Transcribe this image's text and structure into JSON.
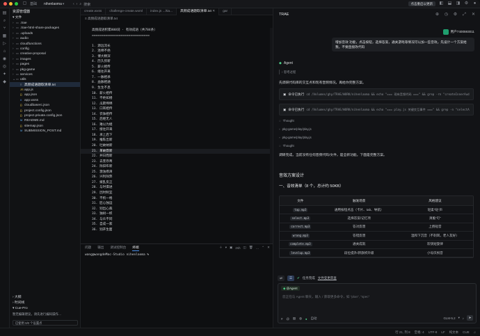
{
  "titlebar": {
    "app_label": "基础",
    "project": "nihenlaoma",
    "search_placeholder": "搜索",
    "update_badge": "点击重启以更新"
  },
  "explorer": {
    "title": "资源管理器",
    "root": "文件",
    "items": [
      {
        "name": ".trae",
        "type": "folder"
      },
      {
        "name": ".trae-html-share-packages",
        "type": "folder"
      },
      {
        "name": ".uploads",
        "type": "folder"
      },
      {
        "name": "audio",
        "type": "folder"
      },
      {
        "name": "cloudfunctions",
        "type": "folder"
      },
      {
        "name": "config",
        "type": "folder"
      },
      {
        "name": "creative-proposal",
        "type": "folder"
      },
      {
        "name": "images",
        "type": "folder"
      },
      {
        "name": "pages",
        "type": "folder"
      },
      {
        "name": "pkg-game",
        "type": "folder"
      },
      {
        "name": "services",
        "type": "folder"
      },
      {
        "name": "utils",
        "type": "folder-open"
      },
      {
        "name": "高频成语题取清单.txt",
        "type": "txt",
        "selected": true
      },
      {
        "name": "app.js",
        "type": "js"
      },
      {
        "name": "app.json",
        "type": "json"
      },
      {
        "name": "app.wxss",
        "type": "css"
      },
      {
        "name": "cloudbaserc.json",
        "type": "json"
      },
      {
        "name": "project.config.json",
        "type": "json"
      },
      {
        "name": "project.private.config.json",
        "type": "json"
      },
      {
        "name": "README.md",
        "type": "md"
      },
      {
        "name": "sitemap.json",
        "type": "json"
      },
      {
        "name": "SUBMISSION_POST.md",
        "type": "md"
      }
    ],
    "outline_label": "大纲",
    "timeline_label": "时间线",
    "cue_title": "Cue-Pro",
    "cue_text": "暂无编辑建议，请先进行编码操作…",
    "cue_status": "已使用 0/0 个设置点"
  },
  "editor": {
    "tabs": [
      "create.wxss",
      "challenge-create.wxml",
      "index.js .../tia...",
      "高频成语题取清单.txt",
      "gar"
    ],
    "active_tab": 3,
    "breadcrumb": "高频成语题取清单.txt",
    "lines": [
      "高频成语积累800词 · 有效成语（共784条）",
      "==============================",
      "",
      "1. 源远流长",
      "2. 连绵不绝",
      "3. 博大精深",
      "4. 历久弥新",
      "5. 薪火相传",
      "6. 继往开来",
      "7. 一脉相承",
      "8. 血脉相通",
      "9. 生生不息",
      "10. 薪火相传",
      "11. 不绝如缕",
      "12. 瓜瓞绵绵",
      "13. 口耳相传",
      "14. 衣钵相传",
      "15. 后继无人",
      "16. 难以为继",
      "17. 接往开来",
      "18. 承上启下",
      "19. 推陈出新",
      "20. 吐故纳新",
      "21. 革故鼎新",
      "22. 并日而新",
      "23. 去芜存菁",
      "24. 除旧布新",
      "25. 激浊扬清",
      "26. 兴利除弊",
      "27. 拨乱反正",
      "28. 与时俱进",
      "29. 因时制宜",
      "30. 不拘一格",
      "31. 匠心独运",
      "32. 别出心裁",
      "33. 独树一帜",
      "34. 与众不同",
      "35. 自成一家",
      "36. 别开生面"
    ],
    "highlight_line": 21,
    "terminal": {
      "tabs": [
        "问题",
        "输出",
        "调试控制台",
        "终端"
      ],
      "active": 3,
      "shell": "zsh",
      "prompt": "wang@wangdeMac-Studio nihenlaoma %"
    }
  },
  "panel": {
    "title": "TRAE",
    "user_name": "用户7400593011",
    "user_message": "增加音效 功能，点击按钮，选择答案，通关游戏等情况可以加一些音效。先设计一个方案给我，不要直接改代码",
    "agent_label": "Agent",
    "thinking_label": "思考过程",
    "intro": "先调研代码库的交互点和现有音频情况，再给你完整方案。",
    "cmd1_label": "命令已执行",
    "cmd1_path": "cd /Volumes/ghy/TRAE/WORK/nihenlaoma && echo \"=== 现有音频代码 ===\" && grep -rn \"createInnerAudioCo",
    "cmd2_label": "命令已执行",
    "cmd2_path": "cd /Volumes/ghy/TRAE/WORK/nihenlaoma && echo \"=== play.js 关键交互事件 ===\" && grep -n \"selectAnswer\\|",
    "thought1": "Thought",
    "file1": "pkg-game/play/play.js",
    "file2": "pkg-game/play/play.js",
    "thought2": "Thought",
    "summary": "调研完成。当前没有任何音频代码/文件，是全新功能。下面是完整方案。",
    "h1": "音效方案设计",
    "h2": "一、音效清单（8 个，总计约 50KB）",
    "table_headers": [
      "文件",
      "触发场景",
      "风格建议"
    ],
    "table_rows": [
      [
        "tap.mp3",
        "通用按钮点击（卡片、tab、导航）",
        "轻柔“哒”声"
      ],
      [
        "select.mp3",
        "选择答案/记忆项",
        "清脆“叮”"
      ],
      [
        "correct.mp3",
        "答对反馈",
        "上扬短音"
      ],
      [
        "wrong.mp3",
        "答错反馈",
        "温和下沉音（不刺耳，老人友好）"
      ],
      [
        "complete.mp3",
        "通关成就",
        "欢快短旋律"
      ],
      [
        "levelup.mp3",
        "段位提升/新旗帜升级",
        "小号庆祝音"
      ]
    ],
    "task_label": "任务完成",
    "task_link": "文件变更审查",
    "agent_chip": "@Agent",
    "input_placeholder": "您正在与 Agent 聊天，输入 / 获取更多命令，如 \"plan\", \"spec\"",
    "model": "GLM-5.2",
    "auto_label": "自动"
  },
  "statusbar": {
    "position": "行 21, 列 8",
    "spaces": "空格: 4",
    "encoding": "UTF-8",
    "eol": "LF",
    "lang": "纯文本",
    "cue": "CUE"
  }
}
